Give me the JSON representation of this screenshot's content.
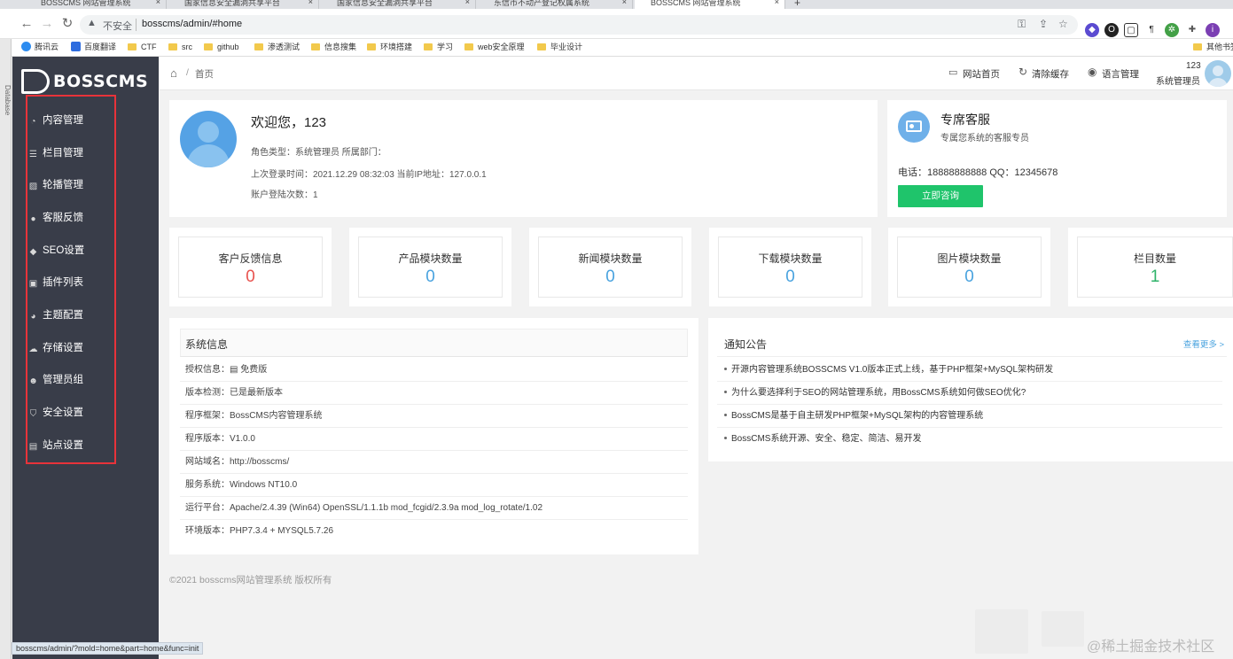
{
  "browser": {
    "tabs": [
      {
        "label": "BOSSCMS 网站管理系统"
      },
      {
        "label": "国家信息安全漏洞共享平台"
      },
      {
        "label": "国家信息安全漏洞共享平台"
      },
      {
        "label": "东信市不动产登记权属系统"
      },
      {
        "label": "BOSSCMS 网站管理系统"
      }
    ],
    "insecure_label": "不安全",
    "url": "bosscms/admin/#home",
    "bookmarks": [
      "腾讯云",
      "百度翻译",
      "CTF",
      "src",
      "github",
      "渗透测试",
      "信息搜集",
      "环境搭建",
      "学习",
      "web安全原理",
      "毕业设计"
    ],
    "other_bookmarks": "其他书签",
    "side_strip": "Database",
    "status_url": "bosscms/admin/?mold=home&part=home&func=init"
  },
  "sidebar": {
    "logo": "BOSSCMS",
    "items": [
      {
        "label": "内容管理",
        "icon": "pie-chart-icon"
      },
      {
        "label": "栏目管理",
        "icon": "list-icon"
      },
      {
        "label": "轮播管理",
        "icon": "image-icon"
      },
      {
        "label": "客服反馈",
        "icon": "chat-icon"
      },
      {
        "label": "SEO设置",
        "icon": "diamond-icon"
      },
      {
        "label": "插件列表",
        "icon": "plugin-icon"
      },
      {
        "label": "主题配置",
        "icon": "palette-icon"
      },
      {
        "label": "存储设置",
        "icon": "cloud-icon"
      },
      {
        "label": "管理员组",
        "icon": "users-icon"
      },
      {
        "label": "安全设置",
        "icon": "shield-icon"
      },
      {
        "label": "站点设置",
        "icon": "settings-icon"
      }
    ]
  },
  "header": {
    "breadcrumb_sep": "/",
    "breadcrumb": "首页",
    "site_home": "网站首页",
    "clear_cache": "清除缓存",
    "language": "语言管理",
    "username": "123",
    "role": "系统管理员"
  },
  "profile": {
    "welcome": "欢迎您，123",
    "role_line": "角色类型：系统管理员    所属部门：",
    "login_line": "上次登录时间：2021.12.29 08:32:03    当前IP地址：127.0.0.1",
    "login_count": "账户登陆次数：1"
  },
  "service": {
    "title": "专席客服",
    "subtitle": "专属您系统的客服专员",
    "contact": "电话：18888888888   QQ：12345678",
    "button": "立即咨询"
  },
  "stats": [
    {
      "label": "客户反馈信息",
      "value": "0",
      "color": "#e8534f"
    },
    {
      "label": "产品模块数量",
      "value": "0",
      "color": "#4aa3df"
    },
    {
      "label": "新闻模块数量",
      "value": "0",
      "color": "#4aa3df"
    },
    {
      "label": "下载模块数量",
      "value": "0",
      "color": "#4aa3df"
    },
    {
      "label": "图片模块数量",
      "value": "0",
      "color": "#4aa3df"
    },
    {
      "label": "栏目数量",
      "value": "1",
      "color": "#2fb36a"
    }
  ],
  "system": {
    "title": "系统信息",
    "rows": [
      "授权信息：▤ 免费版",
      "版本检测：已是最新版本",
      "程序框架：BossCMS内容管理系统",
      "程序版本：V1.0.0",
      "网站域名：http://bosscms/",
      "服务系统：Windows NT10.0",
      "运行平台：Apache/2.4.39 (Win64) OpenSSL/1.1.1b mod_fcgid/2.3.9a mod_log_rotate/1.02",
      "环境版本：PHP7.3.4 + MYSQL5.7.26"
    ]
  },
  "notices": {
    "title": "通知公告",
    "more": "查看更多 >",
    "items": [
      "开源内容管理系统BOSSCMS V1.0版本正式上线，基于PHP框架+MySQL架构研发",
      "为什么要选择利于SEO的网站管理系统，用BossCMS系统如何做SEO优化?",
      "BossCMS是基于自主研发PHP框架+MySQL架构的内容管理系统",
      "BossCMS系统开源、安全、稳定、简洁、易开发"
    ]
  },
  "footer": "©2021 bosscms网站管理系统 版权所有",
  "watermark": "@稀土掘金技术社区"
}
